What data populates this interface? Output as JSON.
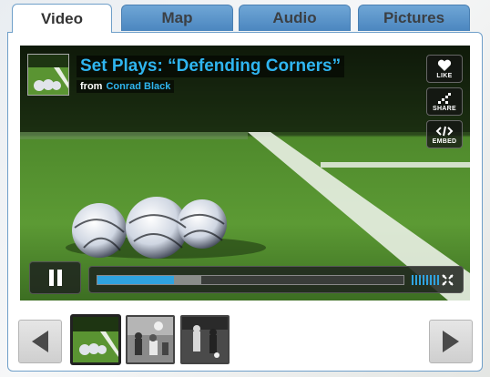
{
  "tabs": [
    {
      "label": "Video",
      "active": true
    },
    {
      "label": "Map",
      "active": false
    },
    {
      "label": "Audio",
      "active": false
    },
    {
      "label": "Pictures",
      "active": false
    }
  ],
  "video": {
    "title": "Set Plays: “Defending Corners”",
    "from_label": "from",
    "author": "Conrad Black",
    "side_buttons": [
      {
        "label": "LIKE",
        "icon": "heart-icon"
      },
      {
        "label": "SHARE",
        "icon": "share-icon"
      },
      {
        "label": "EMBED",
        "icon": "embed-icon"
      }
    ],
    "progress": {
      "played": 0.25,
      "buffered": 0.34
    },
    "volume_level": 1.0
  },
  "carousel": {
    "thumbnails": [
      {
        "name": "thumbnail-balls",
        "active": true
      },
      {
        "name": "thumbnail-players-1",
        "active": false
      },
      {
        "name": "thumbnail-players-2",
        "active": false
      }
    ]
  },
  "colors": {
    "accent": "#2fb5f0",
    "tab_blue": "#5a95cc",
    "panel_border": "#6f9fc9"
  }
}
